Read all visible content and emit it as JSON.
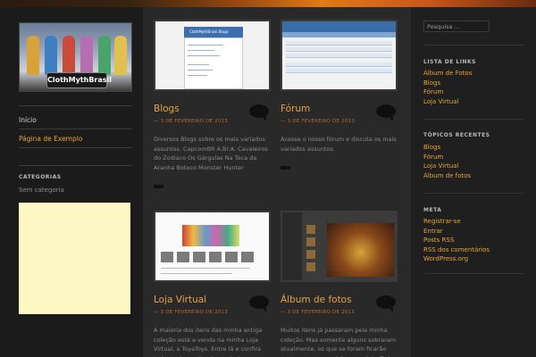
{
  "sidebar_left": {
    "logo_text": "ClothMythBrasil",
    "nav": [
      "Início",
      "Página de Exemplo"
    ],
    "categories_title": "CATEGORIAS",
    "categories_empty": "Sem categoria"
  },
  "posts": [
    {
      "title": "Blogs",
      "date": "— 3 DE FEVEREIRO DE 2013",
      "excerpt": "Diversos Blogs sobre os mais variados assuntos. CapcomBR A.Br.A. Cavaleiros do Zodíaco Os Gárgulas Na Toca da Aranha Boteco Monster Hunter",
      "thumb_caption": "ClothMythBrasil Blogs"
    },
    {
      "title": "Fórum",
      "date": "— 3 DE FEVEREIRO DE 2013",
      "excerpt": "Acesse o nosso fórum e discuta os mais variados assuntos."
    },
    {
      "title": "Loja Virtual",
      "date": "— 3 DE FEVEREIRO DE 2013",
      "excerpt": "A maioria dos itens das minha antiga coleção está a venda na minha Loja Virtual, a ToyaToys. Entre lá e confira tudo, tenho muitos itens ainda lacrados,"
    },
    {
      "title": "Álbum de fotos",
      "date": "— 3 DE FEVEREIRO DE 2013",
      "excerpt": "Muitos itens já passaram pela minha coleção. Mas somente alguns sobraram atualmente, os que se foram ficarão para sempre em minha memória. Todos"
    }
  ],
  "sidebar_right": {
    "search_placeholder": "Pesquisa ...",
    "links_title": "LISTA DE LINKS",
    "links": [
      "Álbum de Fotos",
      "Blogs",
      "Fórum",
      "Loja Virtual"
    ],
    "recent_title": "TÓPICOS RECENTES",
    "recent": [
      "Blogs",
      "Fórum",
      "Loja Virtual",
      "Álbum de fotos"
    ],
    "meta_title": "META",
    "meta": [
      "Registrar-se",
      "Entrar",
      "Posts RSS",
      "RSS dos comentários",
      "WordPress.org"
    ]
  },
  "colors": {
    "accent": "#e8a530",
    "date": "#c0672a",
    "background": "#2b2b2b"
  }
}
